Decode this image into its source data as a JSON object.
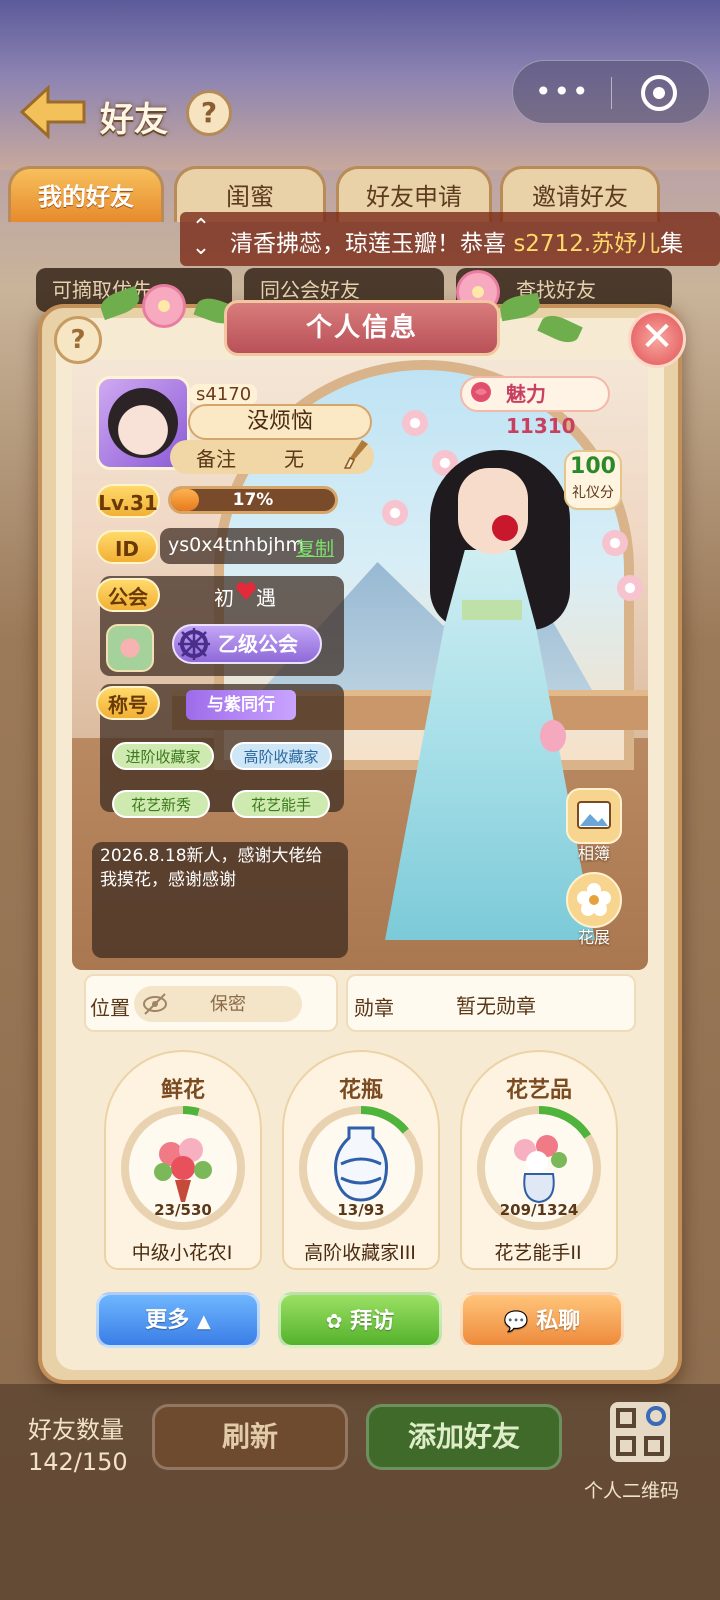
{
  "header": {
    "title": "好友",
    "help_icon": "?"
  },
  "tabs": [
    "我的好友",
    "闺蜜",
    "好友申请",
    "邀请好友"
  ],
  "marquee": {
    "text_before": "清香拂蕊，琼莲玉瓣！恭喜 ",
    "highlight": "s2712.苏妤儿",
    "text_after": "集"
  },
  "underlying_chips": [
    "可摘取优先",
    "同公会好友",
    "查找好友"
  ],
  "modal": {
    "title": "个人信息",
    "close_symbol": "✕",
    "help_symbol": "?",
    "profile": {
      "server": "s4170",
      "name": "没烦恼",
      "remark_label": "备注",
      "remark_value": "无",
      "level_label": "Lv.31",
      "level_progress_percent": 17,
      "level_progress_text": "17%",
      "id_label": "ID",
      "id_value": "ys0x4tnhbjhm",
      "copy_label": "复制",
      "guild_label": "公会",
      "guild_name_left": "初",
      "guild_name_right": "遇",
      "guild_rank": "乙级公会",
      "title_label": "称号",
      "title_badge": "与紫同行",
      "tags": [
        "进阶收藏家",
        "高阶收藏家",
        "花艺新秀",
        "花艺能手"
      ],
      "bio": "2026.8.18新人，感谢大佬给我摸花，感谢感谢"
    },
    "charm": {
      "label": "魅力11310"
    },
    "etiquette": {
      "value": "100",
      "label": "礼仪分"
    },
    "side_buttons": {
      "album": "相簿",
      "exhibition": "花展"
    },
    "location": {
      "label": "位置",
      "value": "保密"
    },
    "medal": {
      "label": "勋章",
      "value": "暂无勋章"
    },
    "collections": [
      {
        "title": "鲜花",
        "count": "23/530",
        "rank": "中级小花农I",
        "progress": 0.043
      },
      {
        "title": "花瓶",
        "count": "13/93",
        "rank": "高阶收藏家III",
        "progress": 0.14
      },
      {
        "title": "花艺品",
        "count": "209/1324",
        "rank": "花艺能手II",
        "progress": 0.158
      }
    ],
    "actions": {
      "more": "更多",
      "visit": "拜访",
      "chat": "私聊"
    }
  },
  "bottom": {
    "friend_count_label": "好友数量",
    "friend_count_value": "142/150",
    "refresh": "刷新",
    "add_friend": "添加好友",
    "qr_label": "个人二维码"
  },
  "colors": {
    "accent": "#f2b035",
    "modal_title": "#b85158",
    "charm": "#c84060"
  }
}
